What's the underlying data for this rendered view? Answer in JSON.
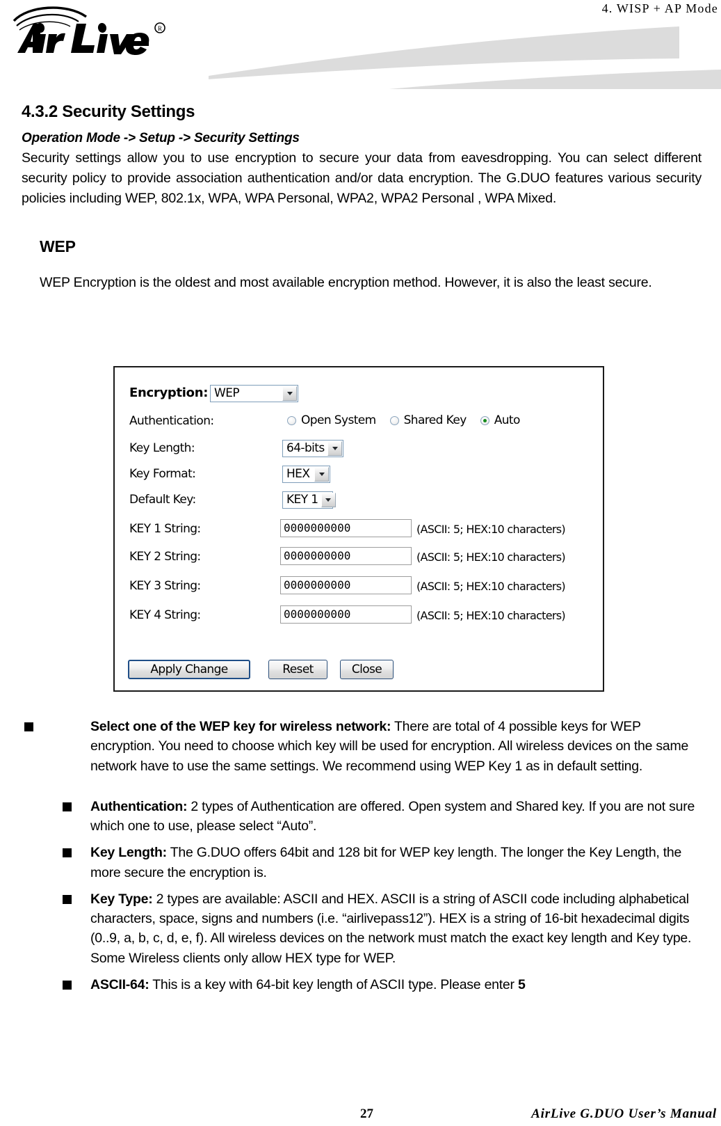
{
  "header": {
    "running_title": "4. WISP + AP Mode",
    "logo_text": "AirLive",
    "logo_registered": "®"
  },
  "document": {
    "section_number_title": "4.3.2 Security Settings",
    "breadcrumb": "Operation Mode -> Setup -> Security Settings",
    "intro_paragraph": "Security settings allow you to use encryption to secure your data from eavesdropping.  You can select different security policy to provide association authentication and/or data encryption.   The G.DUO features various security policies including WEP, 802.1x, WPA, WPA Personal, WPA2, WPA2 Personal , WPA Mixed.",
    "wep_heading": "WEP",
    "wep_description": "WEP Encryption is the oldest and most available encryption method.    However, it is also the least secure."
  },
  "form": {
    "encryption_label": "Encryption:",
    "encryption_value": "WEP",
    "authentication_label": "Authentication:",
    "authentication_options": [
      {
        "label": "Open System",
        "checked": false
      },
      {
        "label": "Shared Key",
        "checked": false
      },
      {
        "label": "Auto",
        "checked": true
      }
    ],
    "key_length_label": "Key Length:",
    "key_length_value": "64-bits",
    "key_format_label": "Key Format:",
    "key_format_value": "HEX",
    "default_key_label": "Default Key:",
    "default_key_value": "KEY 1",
    "key_hint": "(ASCII: 5; HEX:10 characters)",
    "keys": [
      {
        "label": "KEY 1 String:",
        "value": "0000000000"
      },
      {
        "label": "KEY 2 String:",
        "value": "0000000000"
      },
      {
        "label": "KEY 3 String:",
        "value": "0000000000"
      },
      {
        "label": "KEY 4 String:",
        "value": "0000000000"
      }
    ],
    "buttons": {
      "apply": "Apply Change",
      "reset": "Reset",
      "close": "Close"
    }
  },
  "bullets": [
    {
      "bold": "Select one of the WEP key for wireless network:",
      "text": "  There are total of 4 possible keys for WEP encryption.    You need to choose which key will be used for encryption.    All wireless devices on the same network have to use the same settings.    We recommend using WEP Key 1 as in default setting."
    },
    {
      "bold": "Authentication:",
      "text": "   2 types of Authentication are offered.    Open system and Shared key.    If you are not sure which one to use, please select “Auto”."
    },
    {
      "bold": "Key Length:",
      "text": "   The G.DUO offers 64bit and 128 bit for WEP key length.    The longer the Key Length, the more secure the encryption is."
    },
    {
      "bold": "Key Type:",
      "text": "   2 types are available: ASCII and HEX.    ASCII is a string of ASCII code including alphabetical characters, space, signs and numbers (i.e. “airlivepass12”).    HEX is a string of 16-bit hexadecimal digits (0..9, a, b, c, d, e, f).  All wireless devices on the network must match the exact key length and Key type.  Some Wireless clients only allow HEX type for WEP."
    },
    {
      "bold": "ASCII-64:",
      "text": " This is a key with 64-bit key length of ASCII type.    Please enter ",
      "trailing_bold": "5"
    }
  ],
  "footer": {
    "page_number": "27",
    "manual_title": "AirLive G.DUO User’s Manual"
  }
}
